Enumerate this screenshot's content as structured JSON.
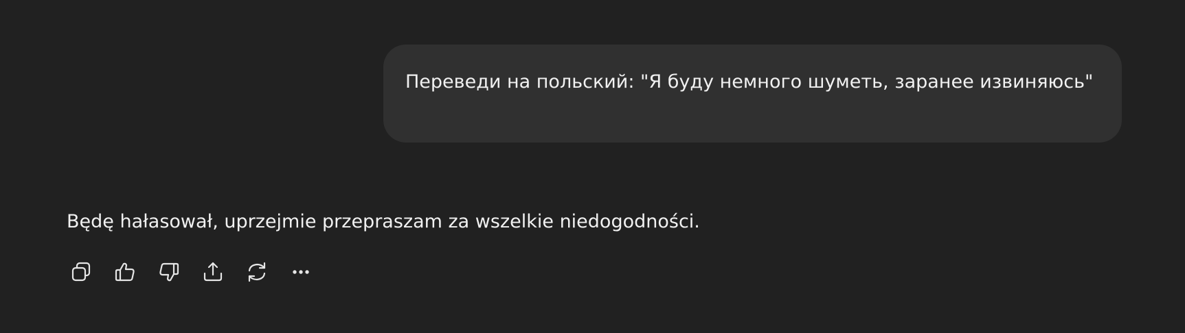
{
  "conversation": {
    "user_message": "Переведи на польский: \"Я буду немного шуметь, заранее извиняюсь\"",
    "assistant_message": "Będę hałasował, uprzejmie przepraszam za wszelkie niedogodności."
  },
  "actions": [
    {
      "icon": "copy-icon"
    },
    {
      "icon": "thumbs-up-icon"
    },
    {
      "icon": "thumbs-down-icon"
    },
    {
      "icon": "share-icon"
    },
    {
      "icon": "regenerate-icon"
    },
    {
      "icon": "more-icon"
    }
  ],
  "colors": {
    "background": "#212121",
    "user_bubble": "#303030",
    "text": "#f1f1f1",
    "icon": "#e6e6e6"
  }
}
